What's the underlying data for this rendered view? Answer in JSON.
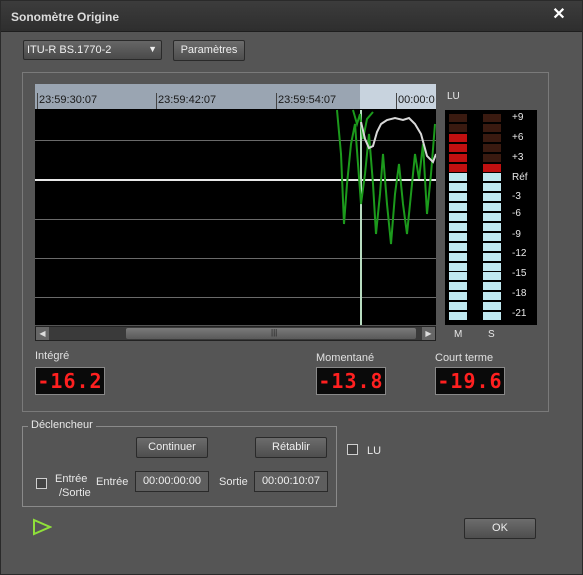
{
  "window": {
    "title": "Sonomètre  Origine",
    "close_glyph": "✕"
  },
  "standard_select": {
    "value": "ITU-R BS.1770-2"
  },
  "buttons": {
    "params": "Paramètres",
    "continue": "Continuer",
    "reset": "Rétablir",
    "ok": "OK"
  },
  "timeline": {
    "labels": [
      "23:59:30:07",
      "23:59:42:07",
      "23:59:54:07",
      "00:00:0"
    ]
  },
  "meter": {
    "unit": "LU",
    "scale": [
      "+9",
      "+6",
      "+3",
      "Réf",
      "-3",
      "-6",
      "-9",
      "-12",
      "-15",
      "-18",
      "-21"
    ],
    "channels": [
      "M",
      "S"
    ],
    "m_level_lu": 6.5,
    "s_level_lu": 1.5
  },
  "readouts": {
    "integrated": {
      "label": "Intégré",
      "value": "-16.2"
    },
    "momentary": {
      "label": "Momentané",
      "value": "-13.8"
    },
    "short_term": {
      "label": "Court terme",
      "value": "-19.6"
    }
  },
  "trigger": {
    "group_label": "Déclencheur",
    "inout_label_1": "Entrée",
    "inout_label_2": "/Sortie",
    "in_label": "Entrée",
    "in_value": "00:00:00:00",
    "out_label": "Sortie",
    "out_value": "00:00:10:07"
  },
  "lu_checkbox_label": "LU",
  "colors": {
    "green": "#1c8c1c",
    "red": "#c01010",
    "cyan": "#bfe8f0"
  }
}
